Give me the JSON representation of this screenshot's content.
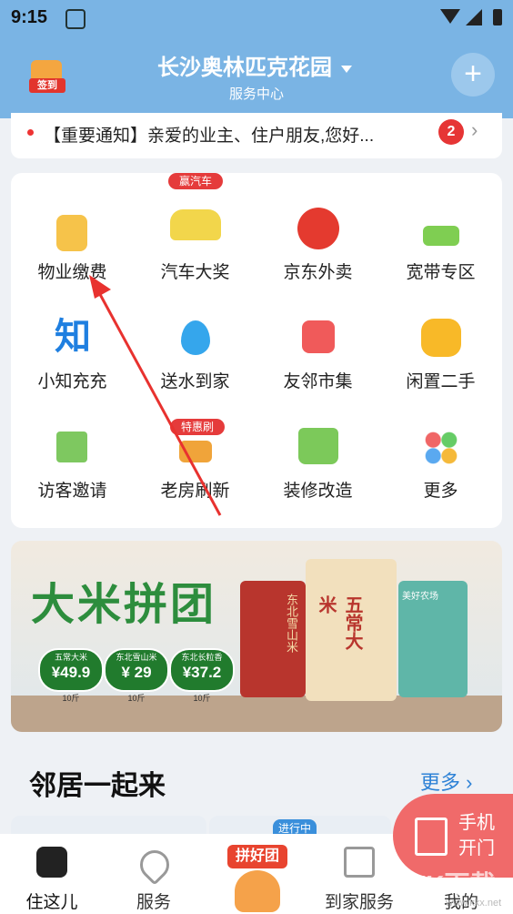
{
  "status": {
    "time": "9:15"
  },
  "header": {
    "signin_label": "签到",
    "title": "长沙奥林匹克花园",
    "subtitle": "服务中心"
  },
  "notice": {
    "text": "【重要通知】亲爱的业主、住户朋友,您好...",
    "count": "2"
  },
  "services": [
    {
      "label": "物业缴费",
      "icon": "wallet-icon"
    },
    {
      "label": "汽车大奖",
      "icon": "car-icon",
      "tag": "赢汽车"
    },
    {
      "label": "京东外卖",
      "icon": "jd-dog-icon"
    },
    {
      "label": "宽带专区",
      "icon": "router-icon"
    },
    {
      "label": "小知充充",
      "icon": "zhi-logo-icon",
      "logo_text": "知"
    },
    {
      "label": "送水到家",
      "icon": "water-drop-icon"
    },
    {
      "label": "友邻市集",
      "icon": "shopping-bag-icon"
    },
    {
      "label": "闲置二手",
      "icon": "coin-stack-icon"
    },
    {
      "label": "访客邀请",
      "icon": "qr-code-icon"
    },
    {
      "label": "老房刷新",
      "icon": "paint-roller-icon",
      "tag": "特惠刷"
    },
    {
      "label": "装修改造",
      "icon": "house-smile-icon"
    },
    {
      "label": "更多",
      "icon": "colorful-dots-icon"
    }
  ],
  "banner": {
    "title": "大米拼团",
    "prices": [
      {
        "name": "五常大米",
        "price": "¥49.9",
        "weight": "10斤"
      },
      {
        "name": "东北雪山米",
        "price": "¥ 29",
        "weight": "10斤"
      },
      {
        "name": "东北长粒香",
        "price": "¥37.2",
        "weight": "10斤"
      }
    ],
    "bag_texts": [
      "东北雪山米",
      "五常大米",
      "美好农场"
    ]
  },
  "section": {
    "title": "邻居一起来",
    "more": "更多 ›",
    "card_tag": "进行中"
  },
  "door_button": {
    "label": "手机开门"
  },
  "tabs": [
    {
      "label": "住这儿",
      "icon": "home-gear-icon"
    },
    {
      "label": "服务",
      "icon": "heart-icon"
    },
    {
      "label": "拼好团",
      "icon": "pinhaotuan-mascot-icon"
    },
    {
      "label": "到家服务",
      "icon": "house-wrench-icon"
    },
    {
      "label": "我的",
      "icon": "profile-icon"
    }
  ],
  "watermark": {
    "text": "KK下载",
    "url": "www.kkx.net"
  },
  "colors": {
    "header": "#7ab4e4",
    "accent": "#2e82d6",
    "badge": "#e63535",
    "door": "#f06a6a"
  }
}
